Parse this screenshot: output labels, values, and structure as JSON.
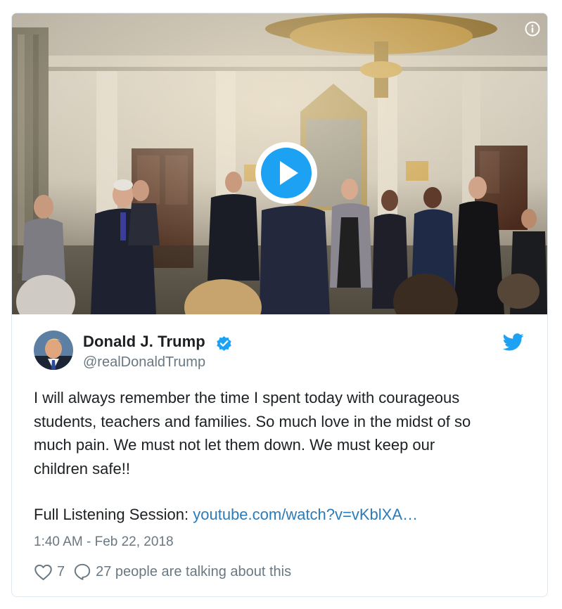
{
  "tweet": {
    "author_name": "Donald J. Trump",
    "handle": "@realDonaldTrump",
    "text_lines": [
      "I will always remember the time I spent today with courageous",
      "students, teachers and families. So much love in the midst of so",
      "much pain. We must not let them down. We must keep our",
      "children safe!!"
    ],
    "session_label": "Full Listening Session:",
    "session_link": "youtube.com/watch?v=vKblXA…",
    "timestamp": "1:40 AM - Feb 22, 2018",
    "likes": "7",
    "talking": "27 people are talking about this"
  },
  "icons": {
    "info": "info-icon",
    "play": "play-icon",
    "verified": "verified-badge-icon",
    "twitter": "twitter-bird-icon",
    "like": "heart-icon",
    "reply": "speech-bubble-icon"
  },
  "colors": {
    "accent": "#1da1f2",
    "link": "#2b7bb9",
    "text": "#1c2022",
    "muted": "#697882",
    "border": "#e1e8ed"
  }
}
